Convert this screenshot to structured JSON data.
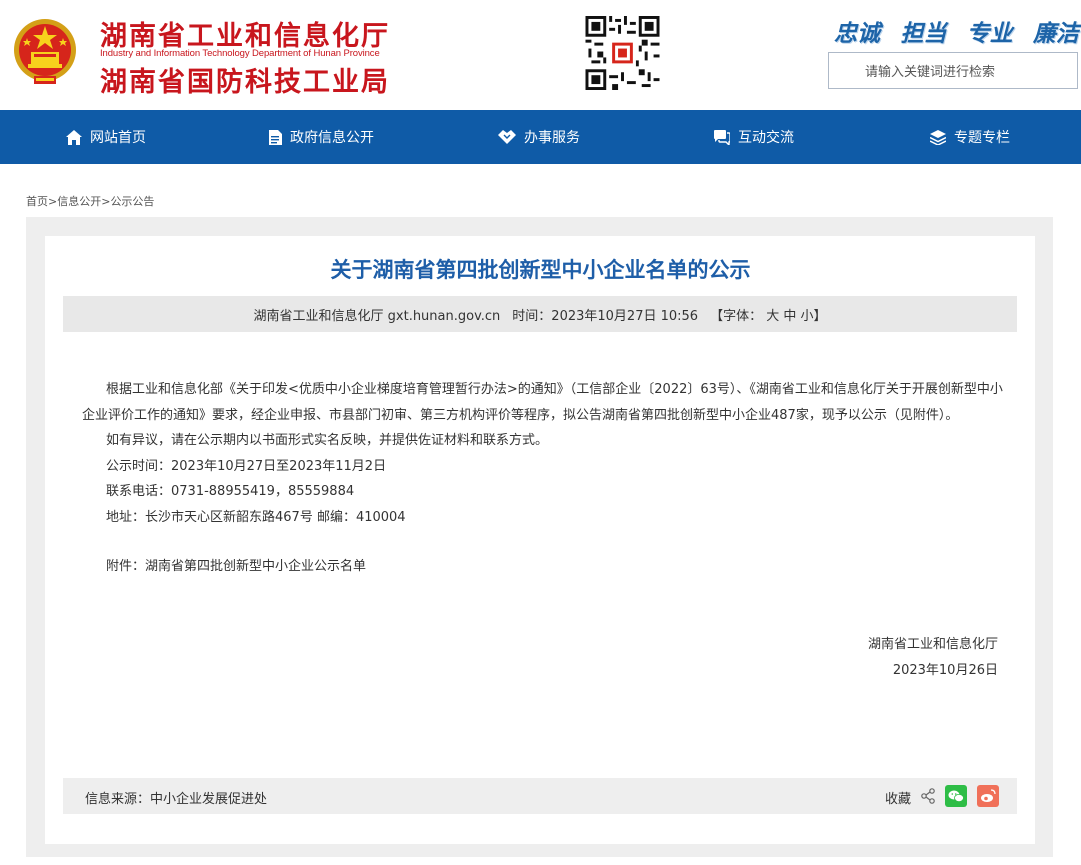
{
  "header": {
    "title_line1": "湖南省工业和信息化厅",
    "title_en": "Industry and Information Technology Department of Hunan Province",
    "title_line2": "湖南省国防科技工业局",
    "slogan": [
      "忠诚",
      "担当",
      "专业",
      "廉洁"
    ],
    "search_placeholder": "请输入关键词进行检索",
    "brand_color": "#c8161d",
    "accent_color": "#0f5ba7"
  },
  "nav": {
    "items": [
      {
        "label": "网站首页",
        "icon": "home-icon"
      },
      {
        "label": "政府信息公开",
        "icon": "document-icon"
      },
      {
        "label": "办事服务",
        "icon": "handshake-icon"
      },
      {
        "label": "互动交流",
        "icon": "chat-icon"
      },
      {
        "label": "专题专栏",
        "icon": "layers-icon"
      }
    ]
  },
  "breadcrumb": {
    "home": "首页",
    "sep": ">",
    "level1": "信息公开",
    "level2": "公示公告"
  },
  "article": {
    "title": "关于湖南省第四批创新型中小企业名单的公示",
    "source_org": "湖南省工业和信息化厅 gxt.hunan.gov.cn",
    "time": "时间：2023年10月27日 10:56",
    "font_label": "【字体： 大 中 小】",
    "para1_line1": "根据工业和信息化部《关于印发<优质中小企业梯度培育管理暂行办法>的通知》（工信部企业〔2022〕63号）、《湖南省工业和信息化厅关于开展创新型中小",
    "para1_line2": "企业评价工作的通知》要求，经企业申报、市县部门初审、第三方机构评价等程序，拟公告湖南省第四批创新型中小企业487家，现予以公示（见附件）。",
    "para2": "如有异议，请在公示期内以书面形式实名反映，并提供佐证材料和联系方式。",
    "period": "公示时间：2023年10月27日至2023年11月2日",
    "phone": "联系电话：0731-88955419，85559884",
    "address": "地址：长沙市天心区新韶东路467号 邮编：410004",
    "attachment": "附件：湖南省第四批创新型中小企业公示名单",
    "sign_org": "湖南省工业和信息化厅",
    "sign_date": "2023年10月26日"
  },
  "footer": {
    "source": "信息来源：中小企业发展促进处",
    "favorite": "收藏"
  }
}
